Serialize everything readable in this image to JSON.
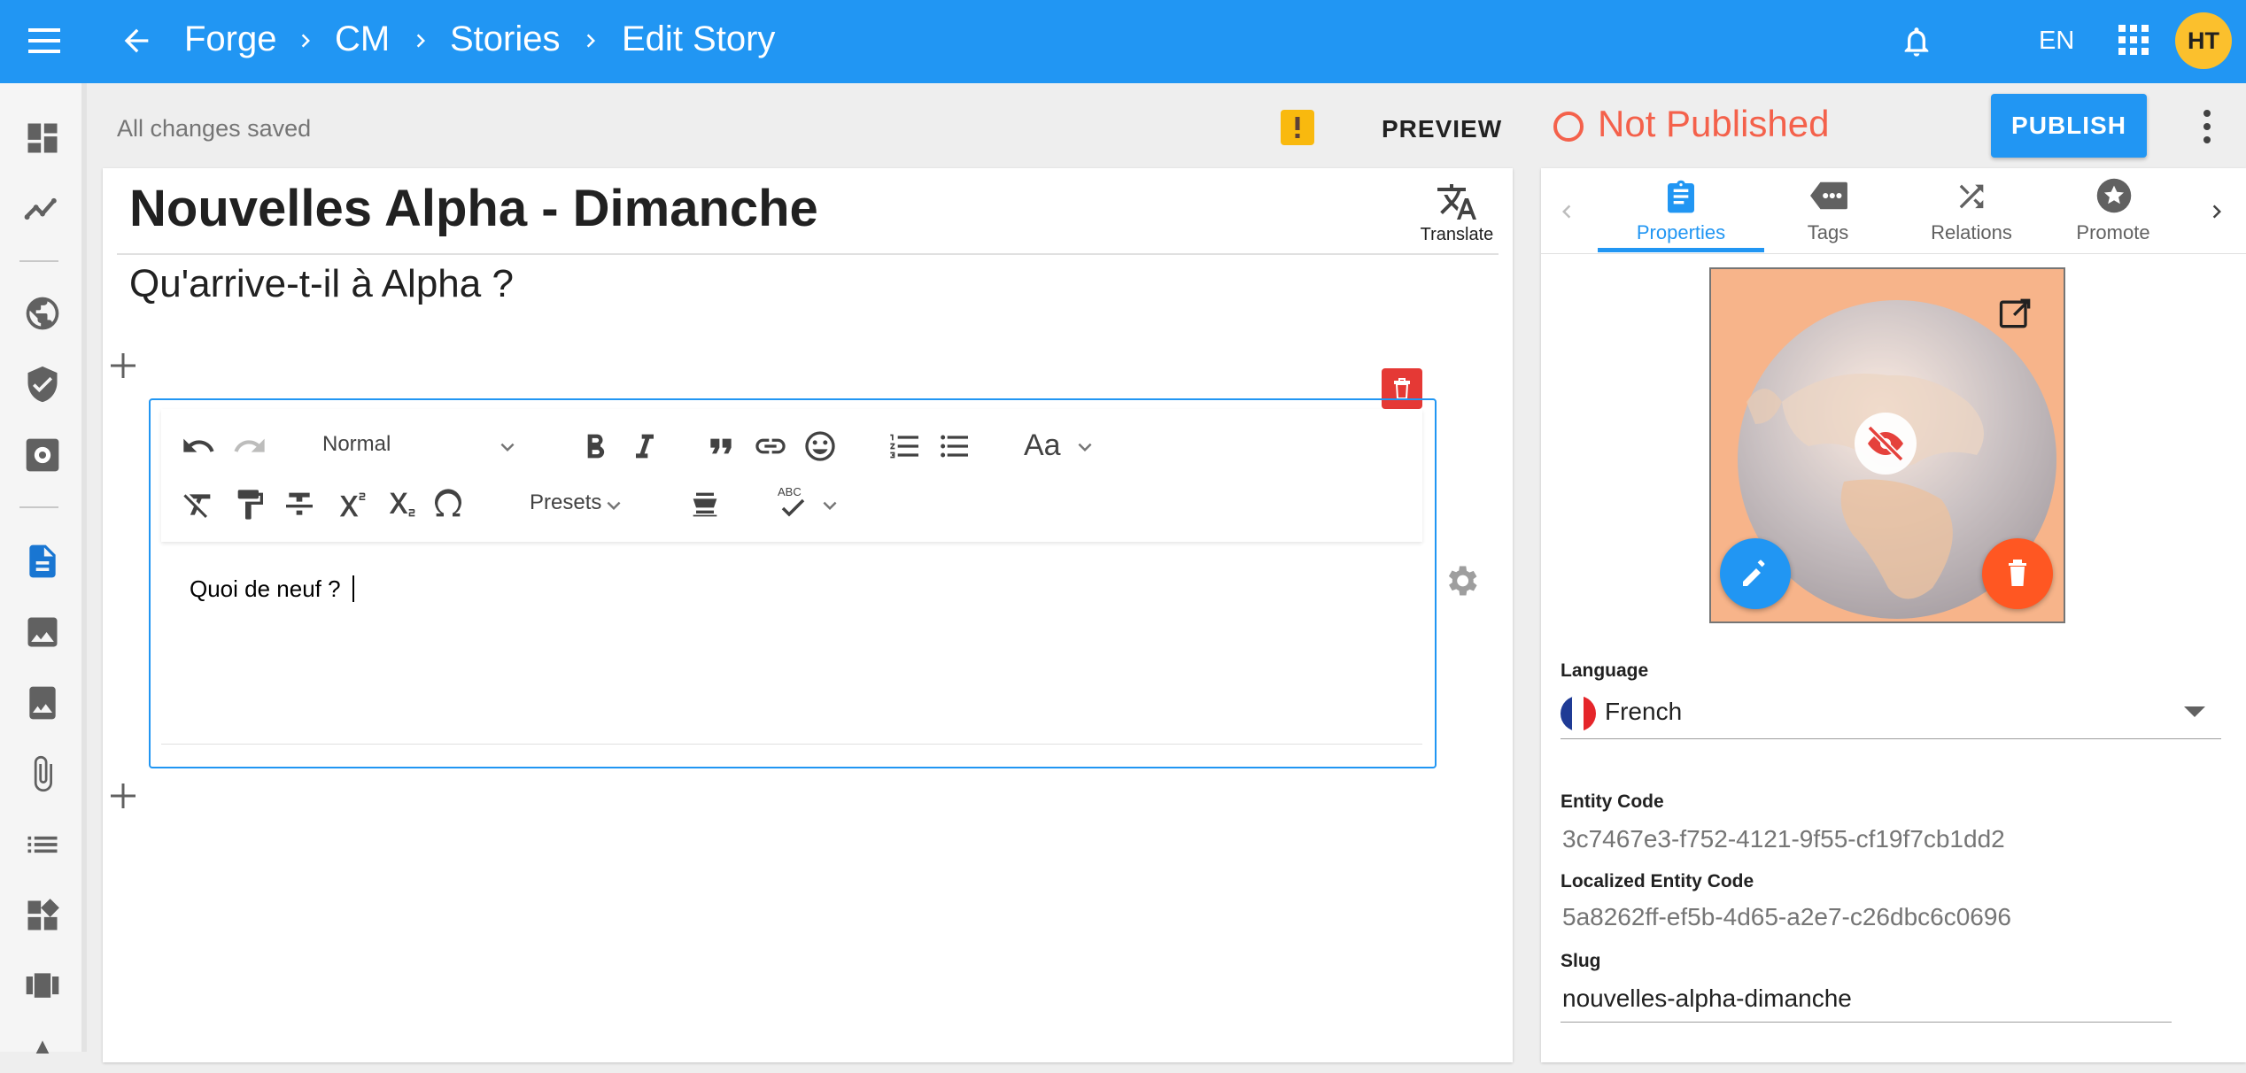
{
  "topbar": {
    "breadcrumbs": [
      "Forge",
      "CM",
      "Stories",
      "Edit Story"
    ],
    "language": "EN",
    "user_initials": "HT",
    "colors": {
      "bar": "#2196f3",
      "avatar": "#fbc02d"
    }
  },
  "actionbar": {
    "save_status": "All changes saved",
    "preview_label": "PREVIEW",
    "publish_status": "Not Published",
    "publish_label": "PUBLISH",
    "colors": {
      "status": "#f4614b",
      "warning": "#f9b90e"
    }
  },
  "story": {
    "title": "Nouvelles Alpha - Dimanche",
    "subtitle": "Qu'arrive-t-il à Alpha ?",
    "translate_label": "Translate",
    "body_text": "Quoi de neuf ?"
  },
  "toolbar": {
    "format_value": "Normal",
    "presets_label": "Presets",
    "font_label": "Aa",
    "spell_label": "ABC"
  },
  "rightpanel": {
    "tabs": [
      {
        "label": "Properties",
        "icon": "clipboard-icon",
        "active": true
      },
      {
        "label": "Tags",
        "icon": "tag-icon",
        "active": false
      },
      {
        "label": "Relations",
        "icon": "shuffle-icon",
        "active": false
      },
      {
        "label": "Promote",
        "icon": "star-badge-icon",
        "active": false
      }
    ],
    "language_label": "Language",
    "language_value": "French",
    "entity_code_label": "Entity Code",
    "entity_code": "3c7467e3-f752-4121-9f55-cf19f7cb1dd2",
    "localized_code_label": "Localized Entity Code",
    "localized_code": "5a8262ff-ef5b-4d65-a2e7-c26dbc6c0696",
    "slug_label": "Slug",
    "slug_value": "nouvelles-alpha-dimanche",
    "colors": {
      "accent": "#2196f3",
      "delete": "#ff5722"
    }
  }
}
